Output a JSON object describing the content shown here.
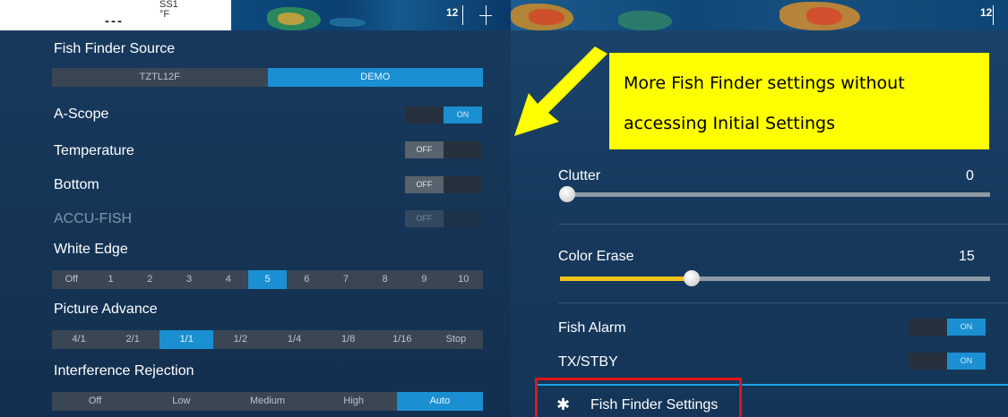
{
  "top_strip": {
    "ss_label": "SS1",
    "ss_sub": "°F",
    "dashes": "‑‑‑",
    "depth_left": "12",
    "depth_right": "12"
  },
  "left": {
    "fish_finder_source": {
      "label": "Fish Finder Source",
      "options": [
        "TZTL12F",
        "DEMO"
      ],
      "selected": "DEMO"
    },
    "a_scope": {
      "label": "A-Scope",
      "state": "ON"
    },
    "temperature": {
      "label": "Temperature",
      "state": "OFF"
    },
    "bottom": {
      "label": "Bottom",
      "state": "OFF"
    },
    "accu_fish": {
      "label": "ACCU-FISH",
      "state": "OFF"
    },
    "white_edge": {
      "label": "White Edge",
      "options": [
        "Off",
        "1",
        "2",
        "3",
        "4",
        "5",
        "6",
        "7",
        "8",
        "9",
        "10"
      ],
      "selected": "5"
    },
    "picture_advance": {
      "label": "Picture Advance",
      "options": [
        "4/1",
        "2/1",
        "1/1",
        "1/2",
        "1/4",
        "1/8",
        "1/16",
        "Stop"
      ],
      "selected": "1/1"
    },
    "interference_rejection": {
      "label": "Interference Rejection",
      "options": [
        "Off",
        "Low",
        "Medium",
        "High",
        "Auto"
      ],
      "selected": "Auto"
    }
  },
  "right": {
    "clutter": {
      "label": "Clutter",
      "value": "0",
      "level": 0
    },
    "color_erase": {
      "label": "Color Erase",
      "value": "15",
      "level": 0.3
    },
    "fish_alarm": {
      "label": "Fish Alarm",
      "state": "ON"
    },
    "tx_stby": {
      "label": "TX/STBY",
      "state": "ON"
    },
    "fish_finder_settings": {
      "label": "Fish Finder Settings",
      "icon": "gear-icon"
    }
  },
  "callout": {
    "line1": "More Fish Finder settings without",
    "line2": "accessing Initial Settings"
  },
  "colors": {
    "accent": "#1a8fd1",
    "callout_bg": "#ffff00",
    "arrow": "#ffff00",
    "highlight_border": "#e0141b",
    "slider_fill": "#f3c21a"
  }
}
